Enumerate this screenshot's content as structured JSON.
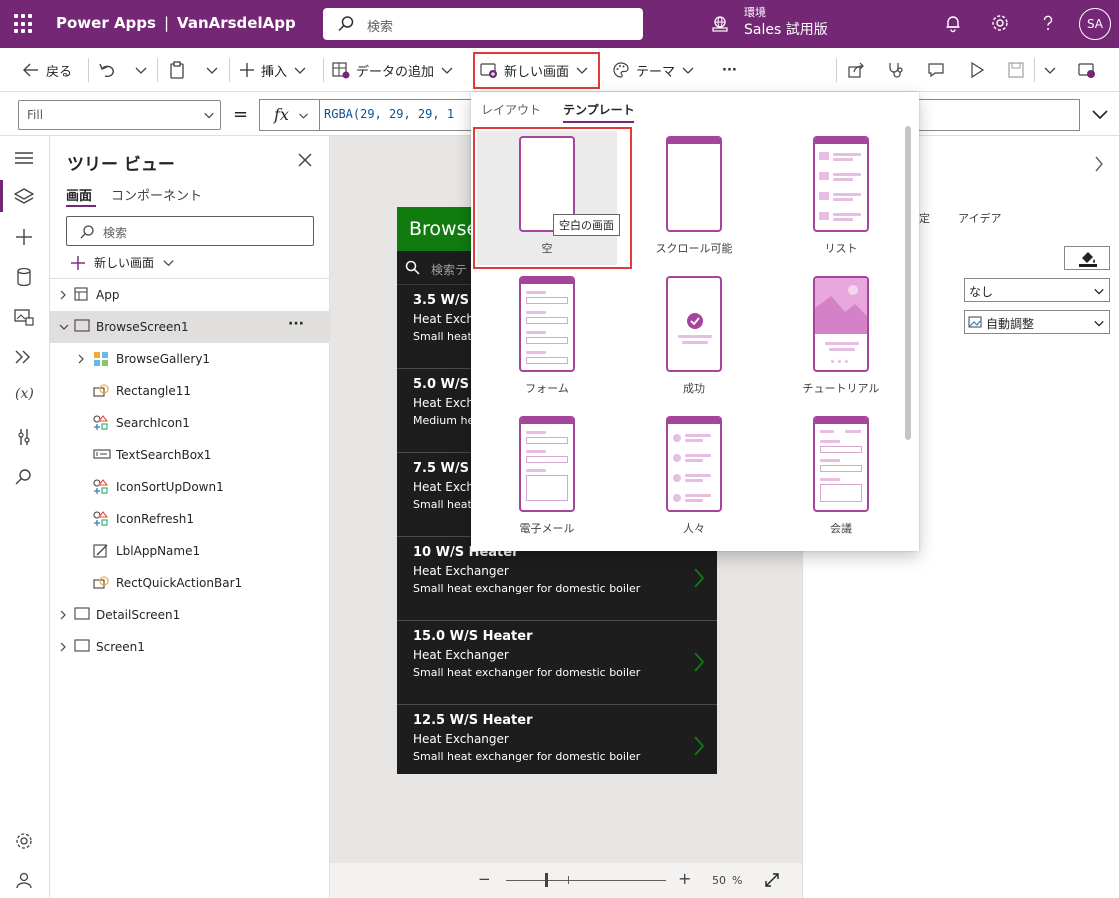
{
  "header": {
    "app_name": "Power Apps",
    "separator": "|",
    "project_name": "VanArsdelApp",
    "search_placeholder": "検索",
    "environment_label": "環境",
    "environment_name": "Sales 試用版",
    "avatar_initials": "SA",
    "bg_color": "#742774"
  },
  "toolbar": {
    "back": "戻る",
    "insert": "挿入",
    "add_data": "データの追加",
    "new_screen": "新しい画面",
    "theme": "テーマ",
    "more": "···"
  },
  "formula_bar": {
    "property": "Fill",
    "equals": "=",
    "fx": "fx",
    "formula": "RGBA(29, 29, 29, 1"
  },
  "tree_view": {
    "title": "ツリー ビュー",
    "tabs": [
      "画面",
      "コンポーネント"
    ],
    "search_placeholder": "検索",
    "new_screen": "新しい画面",
    "more": "···",
    "items": [
      {
        "label": "App"
      },
      {
        "label": "BrowseScreen1"
      },
      {
        "label": "BrowseGallery1"
      },
      {
        "label": "Rectangle11"
      },
      {
        "label": "SearchIcon1"
      },
      {
        "label": "TextSearchBox1"
      },
      {
        "label": "IconSortUpDown1"
      },
      {
        "label": "IconRefresh1"
      },
      {
        "label": "LblAppName1"
      },
      {
        "label": "RectQuickActionBar1"
      },
      {
        "label": "DetailScreen1"
      },
      {
        "label": "Screen1"
      }
    ]
  },
  "canvas": {
    "header_title": "Browse",
    "search_placeholder": "検索テ",
    "accent": "#107c10",
    "items": [
      {
        "title": "3.5 W/S H",
        "subtitle": "Heat Excha",
        "desc": "Small heat e"
      },
      {
        "title": "5.0 W/S H",
        "subtitle": "Heat Excha",
        "desc": "Medium he"
      },
      {
        "title": "7.5 W/S H",
        "subtitle": "Heat Excha",
        "desc": "Small heat e"
      },
      {
        "title": "10 W/S Heater",
        "subtitle": "Heat Exchanger",
        "desc": "Small heat exchanger for domestic boiler"
      },
      {
        "title": "15.0 W/S Heater",
        "subtitle": "Heat Exchanger",
        "desc": "Small heat exchanger for domestic boiler"
      },
      {
        "title": "12.5 W/S Heater",
        "subtitle": "Heat Exchanger",
        "desc": "Small heat exchanger for domestic boiler"
      }
    ]
  },
  "zoom": {
    "value": "50",
    "unit": "%",
    "minus": "−",
    "plus": "+"
  },
  "right_panel": {
    "tab_partial": "定",
    "tab_ideas": "アイデア",
    "select1": "なし",
    "select2": "自動調整"
  },
  "new_screen_menu": {
    "tabs": [
      "レイアウト",
      "テンプレート"
    ],
    "active_tab": "テンプレート",
    "templates": [
      "空",
      "スクロール可能",
      "リスト",
      "フォーム",
      "成功",
      "チュートリアル",
      "電子メール",
      "人々",
      "会議"
    ],
    "tooltip": "空白の画面",
    "accent": "#a4459b"
  }
}
